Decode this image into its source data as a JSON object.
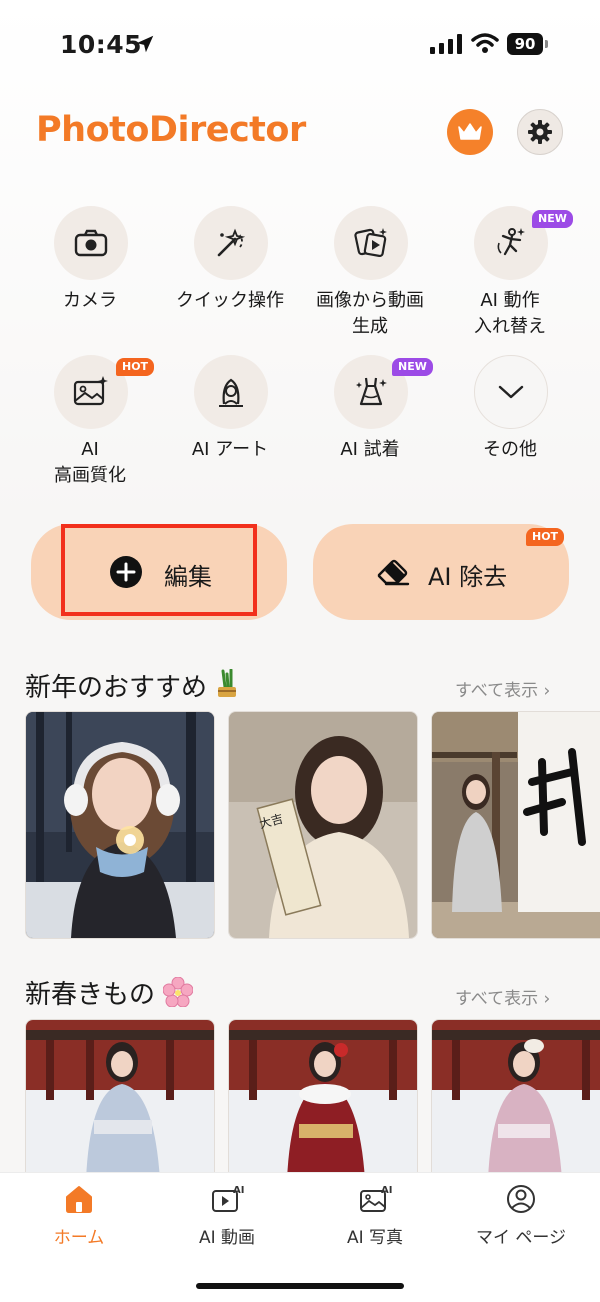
{
  "status_bar": {
    "time": "10:45",
    "battery": "90"
  },
  "header": {
    "app_name": "PhotoDirector",
    "brand_color": "#f37a27"
  },
  "features": [
    {
      "label": "カメラ",
      "icon": "camera-icon"
    },
    {
      "label": "クイック操作",
      "icon": "magic-wand-icon"
    },
    {
      "label": "画像から動画\n生成",
      "icon": "image-to-video-icon"
    },
    {
      "label": "AI 動作\n入れ替え",
      "icon": "dance-motion-icon",
      "badge": "NEW"
    },
    {
      "label": "AI\n高画質化",
      "icon": "image-enhance-icon",
      "badge": "HOT"
    },
    {
      "label": "AI アート",
      "icon": "art-portrait-icon"
    },
    {
      "label": "AI 試着",
      "icon": "dress-icon",
      "badge": "NEW"
    },
    {
      "label": "その他",
      "icon": "chevron-down-icon"
    }
  ],
  "actions": {
    "edit_label": "編集",
    "remove_label": "AI 除去",
    "remove_badge": "HOT"
  },
  "sections": [
    {
      "title": "新年のおすすめ",
      "see_all": "すべて表示"
    },
    {
      "title": "新春きもの",
      "see_all": "すべて表示"
    }
  ],
  "nav": [
    {
      "label": "ホーム",
      "icon": "home-icon",
      "active": true
    },
    {
      "label": "AI 動画",
      "icon": "ai-video-icon"
    },
    {
      "label": "AI 写真",
      "icon": "ai-photo-icon"
    },
    {
      "label": "マイ ページ",
      "icon": "profile-icon"
    }
  ]
}
